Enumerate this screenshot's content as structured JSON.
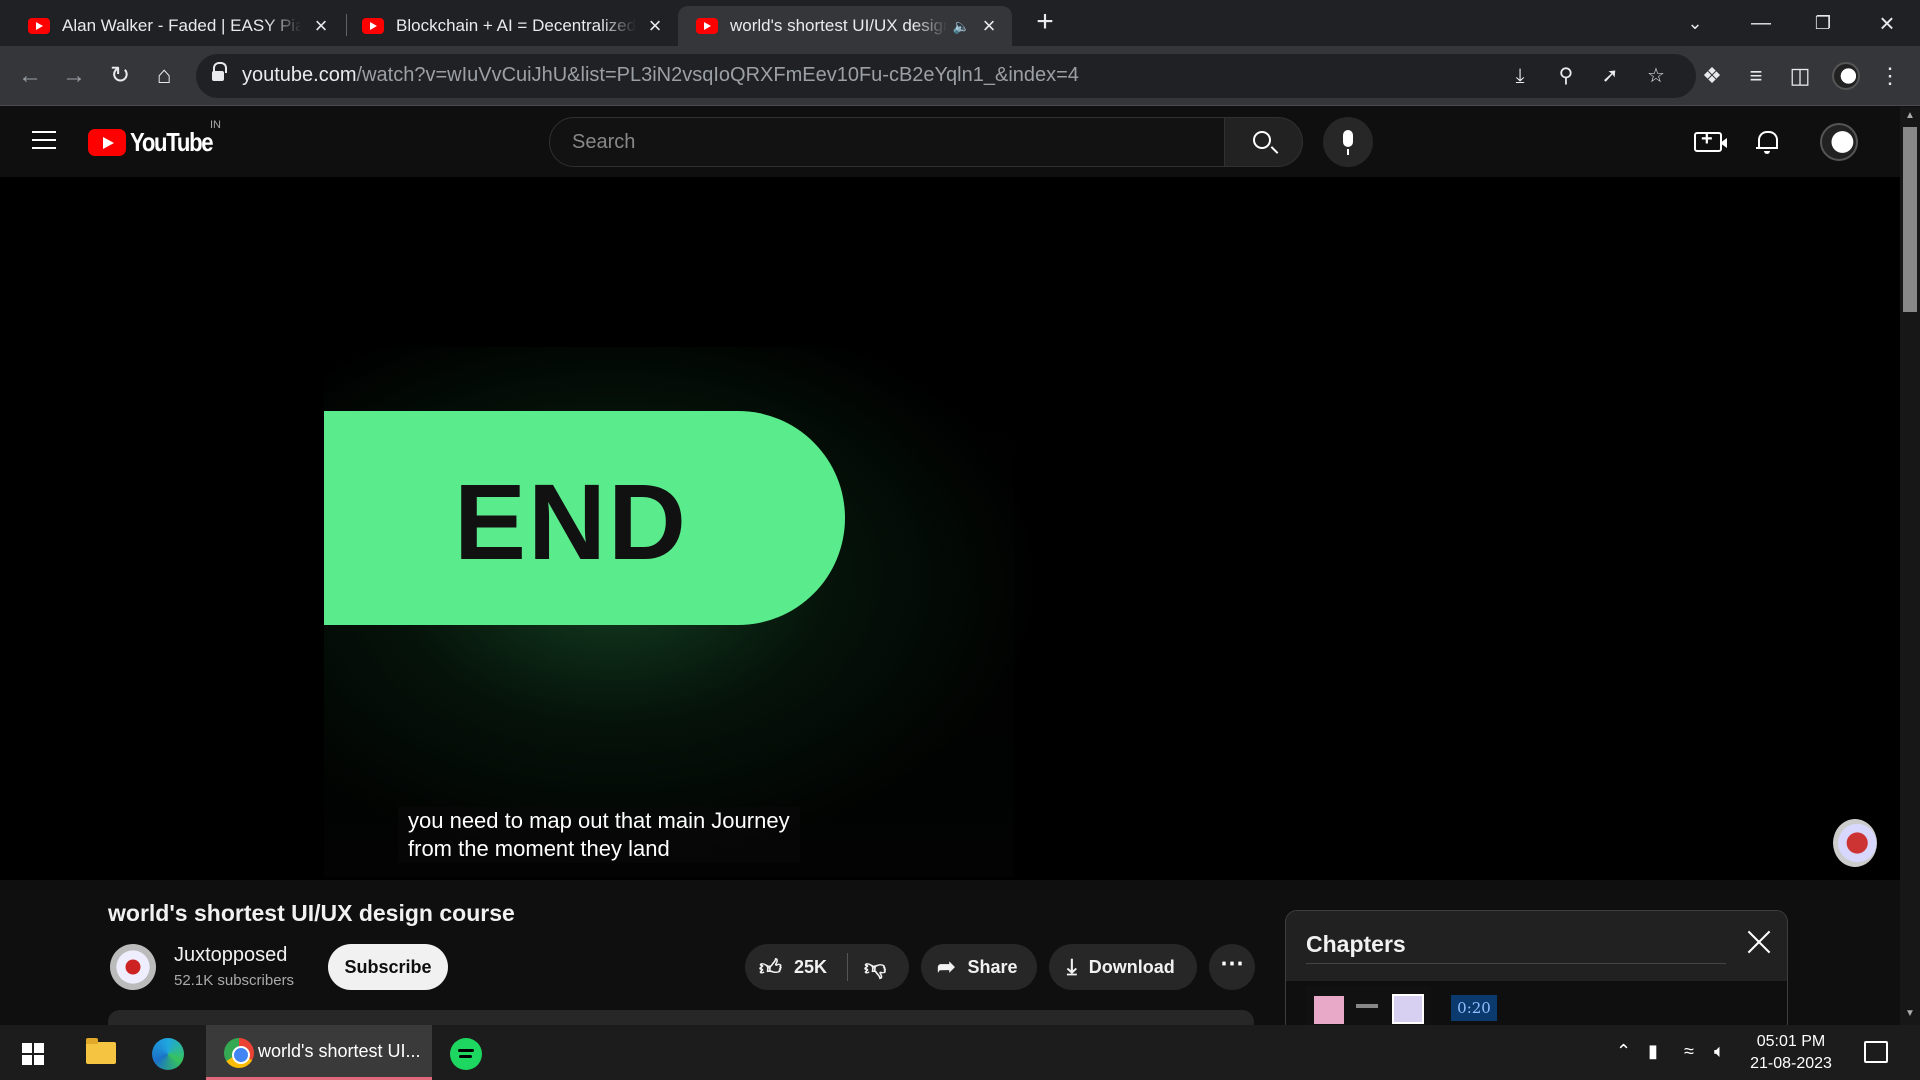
{
  "browser": {
    "tabs": [
      {
        "title": "Alan Walker - Faded | EASY Piano Tutorial"
      },
      {
        "title": "Blockchain + AI = Decentralized AI"
      },
      {
        "title": "world's shortest UI/UX design course"
      }
    ],
    "url_host": "youtube.com",
    "url_path": "/watch?v=wIuVvCuiJhU&list=PL3iN2vsqIoQRXFmEev10Fu-cB2eYqln1_&index=4"
  },
  "youtube": {
    "logo_text": "YouTube",
    "country_code": "IN",
    "search_placeholder": "Search"
  },
  "video": {
    "frame_text": "END",
    "caption_line1": "you need to map out that main Journey",
    "caption_line2": "from the moment they land",
    "title": "world's shortest UI/UX design course",
    "channel_name": "Juxtopposed",
    "subscribers": "52.1K subscribers",
    "subscribe_label": "Subscribe",
    "likes": "25K",
    "share_label": "Share",
    "download_label": "Download"
  },
  "chapters": {
    "title": "Chapters",
    "items": [
      {
        "time": "0:20"
      }
    ]
  },
  "taskbar": {
    "chrome_label": "world's shortest UI...",
    "time": "05:01 PM",
    "date": "21-08-2023"
  },
  "colors": {
    "end_pill": "#5aeb8c",
    "youtube_red": "#ff0000",
    "chapter_time_bg": "#0b3a6e"
  }
}
